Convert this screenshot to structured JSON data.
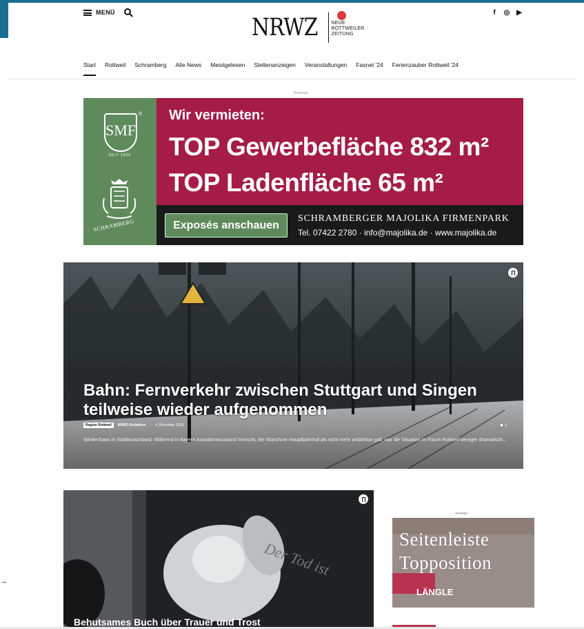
{
  "header": {
    "menu_label": "MENÜ",
    "logo_main": "NRWZ",
    "logo_sub_1": "NEUE",
    "logo_sub_2": "ROTTWEILER",
    "logo_sub_3": "ZEITUNG",
    "social": [
      {
        "icon": "facebook-icon",
        "glyph": "f"
      },
      {
        "icon": "instagram-icon",
        "glyph": "◎"
      },
      {
        "icon": "youtube-icon",
        "glyph": "▶"
      }
    ]
  },
  "nav": {
    "items": [
      "Start",
      "Rottweil",
      "Schramberg",
      "Alle News",
      "Meistgelesen",
      "Stellenanzeigen",
      "Veranstaltungen",
      "Fasnet '24",
      "Ferienzauber Rottweil '24"
    ],
    "active_index": 0
  },
  "ad_label": "Anzeige",
  "banner": {
    "heading": "Wir vermieten:",
    "line1": "TOP Gewerbefläche 832 m²",
    "line2": "TOP Ladenfläche 65 m²",
    "button": "Exposés anschauen",
    "firm": "SCHRAMBERGER MAJOLIKA FIRMENPARK",
    "contact": "Tel. 07422 2780 · info@majolika.de · www.majolika.de",
    "logo_letters": "SMF",
    "logo_reg": "®",
    "logo_since": "SEIT 1820",
    "town": "SCHRAMBERG",
    "colors": {
      "green": "#5f8a5c",
      "red": "#a51c45",
      "dark": "#1a1a1a"
    }
  },
  "hero": {
    "title": "Bahn: Fernverkehr zwischen Stuttgart und Singen teilweise wieder aufgenommen",
    "category": "Region Rottweil",
    "author": "NRWZ-Redaktion",
    "date": "4. Dezember 2023",
    "comments": "1",
    "excerpt": "Winterchaos in Süddeutschland: Während in Bayern Ausnahmezustand herrscht, der Münchner Hauptbahnhof als nicht mehr anfahrbar galt, war die Situation im Raum Rottweil weniger dramatisch..."
  },
  "card2": {
    "title": "Behutsames Buch über Trauer und Trost"
  },
  "sidebar": {
    "label": "Anzeige",
    "placeholder_line1": "Seitenleiste",
    "placeholder_line2": "Topposition",
    "brand": "LÄNGLE"
  }
}
